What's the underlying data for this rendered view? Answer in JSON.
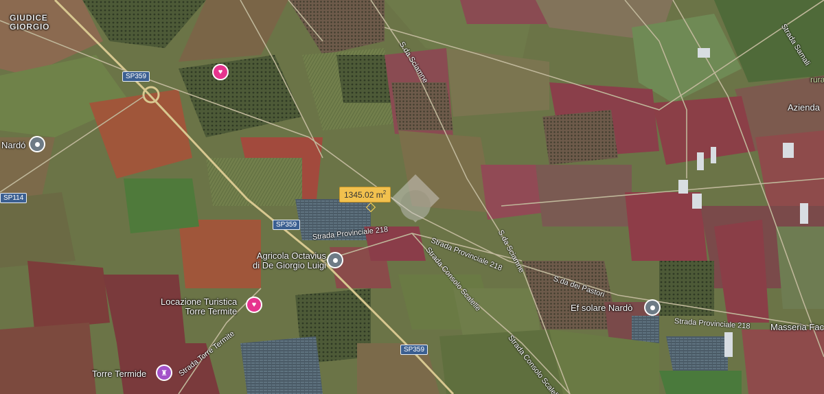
{
  "map": {
    "area_label": {
      "value": "1345.02 m",
      "unit_sup": "2"
    },
    "places": [
      {
        "id": "giudice",
        "text": "GIUDICE\nGIORGIO"
      },
      {
        "id": "nardo",
        "text": "Nardó"
      },
      {
        "id": "agricola",
        "text": "Agricola Octavius\ndi De Giorgio Luigi"
      },
      {
        "id": "locazione",
        "text": "Locazione Turistica\nTorre Termite"
      },
      {
        "id": "torre_termide",
        "text": "Torre Termide"
      },
      {
        "id": "efsolare",
        "text": "Ef solare Nardò"
      },
      {
        "id": "azienda",
        "text": "Azienda"
      },
      {
        "id": "rura",
        "text": "rura"
      },
      {
        "id": "masseria",
        "text": "Masseria Fac"
      }
    ],
    "roads": {
      "sp359_a": "SP359",
      "sp359_b": "SP359",
      "sp359_c": "SP359",
      "sp114": "SP114",
      "sp218_a": "Strada Provinciale 218",
      "sp218_b": "Strada Provinciale 218",
      "sp218_c": "Strada Provinciale 218",
      "consolo_a": "Strada Consolo Scalelle",
      "consolo_b": "Strada Consolo Scalelle",
      "sciamne_a": "S.da Sciamne",
      "sciamne_b": "S.da Sciamne",
      "pastori": "S.da dei Pastori",
      "torre_termite": "Strada Torre Termite",
      "samali": "Strada Samali"
    },
    "icons": {
      "hotel": "bed-icon",
      "place": "place-marker-icon",
      "monument": "castle-icon",
      "energy": "building-icon",
      "watermark": "logo-watermark-icon"
    }
  }
}
